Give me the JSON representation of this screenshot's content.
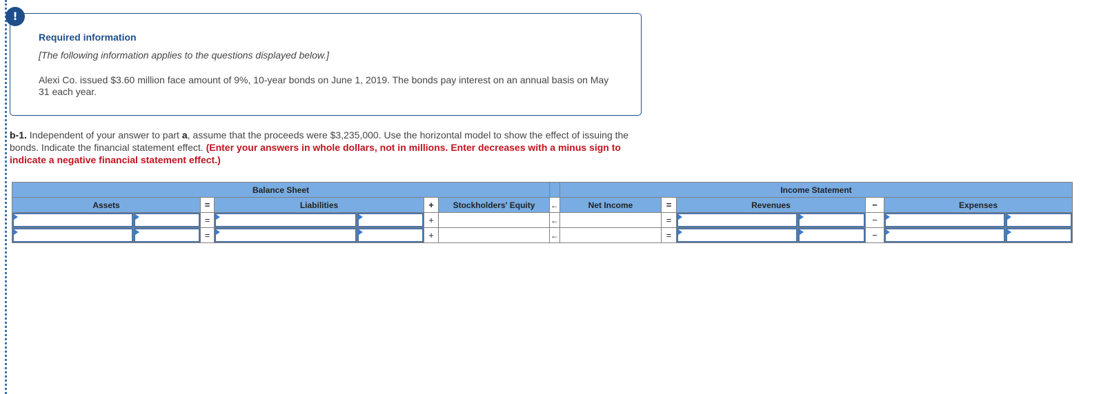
{
  "info": {
    "icon": "exclamation-icon",
    "icon_glyph": "!",
    "title": "Required information",
    "note": "[The following information applies to the questions displayed below.]",
    "body": "Alexi Co. issued $3.60 million face amount of 9%, 10-year bonds on June 1, 2019. The bonds pay interest on an annual basis on May 31 each year."
  },
  "question": {
    "label": "b-1.",
    "text_1": " Independent of your answer to part ",
    "part_ref": "a",
    "text_2": ", assume that the proceeds were $3,235,000. Use the horizontal model to show the effect of issuing the bonds. Indicate the financial statement effect. ",
    "instruction": "(Enter your answers in whole dollars, not in millions. Enter decreases with a minus sign to indicate a negative financial statement effect.)"
  },
  "table": {
    "group_headers": {
      "balance_sheet": "Balance Sheet",
      "income_statement": "Income Statement"
    },
    "columns": {
      "assets": "Assets",
      "equals_1": "=",
      "liabilities": "Liabilities",
      "plus": "+",
      "stockholders_equity": "Stockholders' Equity",
      "arrow": "←",
      "net_income": "Net Income",
      "equals_2": "=",
      "revenues": "Revenues",
      "minus": "−",
      "expenses": "Expenses"
    },
    "rows": [
      {
        "assets_account": "",
        "assets_amount": "",
        "liabilities_account": "",
        "liabilities_amount": "",
        "stockholders_equity": "",
        "net_income": "",
        "revenues_account": "",
        "revenues_amount": "",
        "expenses_account": "",
        "expenses_amount": ""
      },
      {
        "assets_account": "",
        "assets_amount": "",
        "liabilities_account": "",
        "liabilities_amount": "",
        "stockholders_equity": "",
        "net_income": "",
        "revenues_account": "",
        "revenues_amount": "",
        "expenses_account": "",
        "expenses_amount": ""
      }
    ]
  },
  "colors": {
    "brand_blue": "#1f4e89",
    "header_blue": "#78ace3",
    "instruction_red": "#c0131f",
    "input_border": "#4a74a8"
  }
}
